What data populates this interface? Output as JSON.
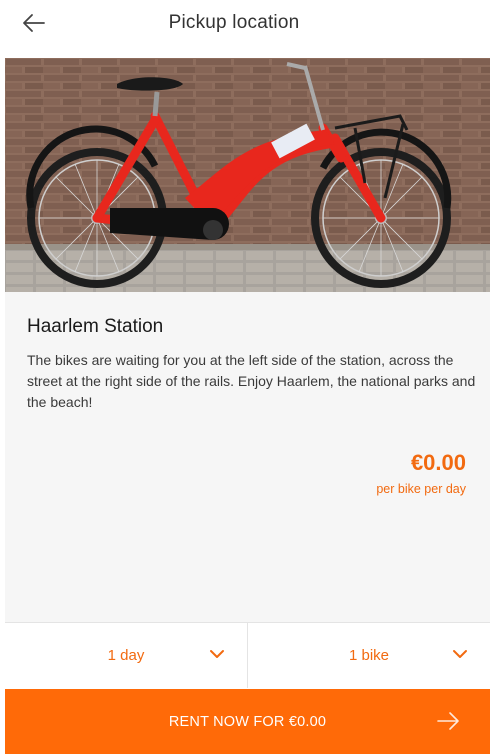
{
  "header": {
    "title": "Pickup location",
    "back_icon": "arrow-left-icon"
  },
  "location": {
    "name": "Haarlem Station",
    "description": "The bikes are waiting for you at the left side of the station, across the street at the right side of the rails. Enjoy Haarlem, the national parks and the beach!",
    "price": "€0.00",
    "price_unit": "per bike per day"
  },
  "selectors": {
    "duration": "1 day",
    "bikes": "1 bike"
  },
  "rent": {
    "label": "RENT NOW FOR €0.00",
    "arrow_icon": "arrow-right-icon"
  },
  "colors": {
    "accent": "#ff6a08",
    "accent_text": "#f26a10",
    "bike": "#e8271d"
  }
}
